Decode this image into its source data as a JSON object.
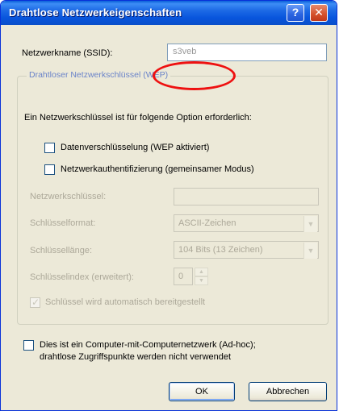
{
  "window": {
    "title": "Drahtlose Netzwerkeigenschaften",
    "help_glyph": "?",
    "close_glyph": "✕"
  },
  "ssid": {
    "label": "Netzwerkname (SSID):",
    "value": "s3veb",
    "annotation_color": "#ee1111"
  },
  "security": {
    "group_title": "Drahtloser Netzwerkschlüssel (WEP)",
    "info": "Ein Netzwerkschlüssel ist für folgende Option erforderlich:",
    "encryption_label": "Datenverschlüsselung (WEP aktiviert)",
    "auth_label": "Netzwerkauthentifizierung (gemeinsamer Modus)",
    "key_label": "Netzwerkschlüssel:",
    "format_label": "Schlüsselformat:",
    "format_value": "ASCII-Zeichen",
    "length_label": "Schlüssellänge:",
    "length_value": "104 Bits (13 Zeichen)",
    "index_label": "Schlüsselindex (erweitert):",
    "index_value": "0",
    "auto_key_label": "Schlüssel wird automatisch bereitgestellt"
  },
  "adhoc": {
    "line1": "Dies ist ein Computer-mit-Computernetzwerk (Ad-hoc);",
    "line2": "drahtlose Zugriffspunkte werden nicht verwendet"
  },
  "buttons": {
    "ok": "OK",
    "cancel": "Abbrechen"
  }
}
